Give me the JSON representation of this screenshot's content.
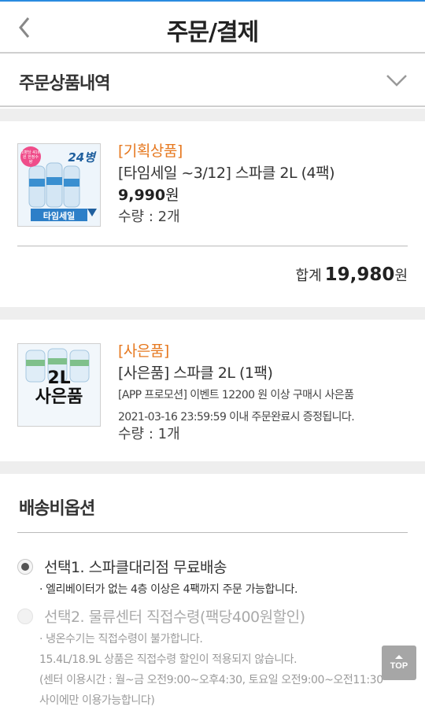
{
  "header": {
    "title": "주문/결제"
  },
  "order_section": {
    "title": "주문상품내역"
  },
  "products": [
    {
      "tag": "[기획상품]",
      "name": "[타임세일 ~3/12] 스파클 2L (4팩)",
      "price": "9,990",
      "price_unit": "원",
      "qty": "수량 : 2개",
      "thumb": {
        "badge": "1병당 416원 한정수량",
        "count": "24병",
        "label": "타임세일"
      }
    },
    {
      "tag": "[사은품]",
      "name": "[사은품] 스파클 2L (1팩)",
      "event_line1": "[APP 프로모션] 이벤트 12200 원 이상 구매시 사은품",
      "event_line2": "2021-03-16 23:59:59 이내 주문완료시 증정됩니다.",
      "qty": "수량 : 1개",
      "thumb": {
        "line1": "2L",
        "line2": "사은품"
      }
    }
  ],
  "total": {
    "label": "합계",
    "value": "19,980",
    "unit": "원"
  },
  "delivery": {
    "title": "배송비옵션",
    "options": [
      {
        "label": "선택1. 스파클대리점 무료배송",
        "selected": true,
        "notes": [
          "· 엘리베이터가 없는 4층 이상은 4팩까지 주문 가능합니다."
        ]
      },
      {
        "label": "선택2. 물류센터 직접수령(팩당400원할인)",
        "selected": false,
        "notes": [
          "· 냉온수기는 직접수령이 불가합니다.",
          "15.4L/18.9L 상품은 직접수령 할인이 적용되지 않습니다.",
          "(센터 이용시간 : 월~금 오전9:00~오후4:30, 토요일 오전9:00~오전11:30",
          "사이에만 이용가능합니다)"
        ]
      }
    ]
  },
  "top_button": {
    "label": "TOP"
  },
  "colors": {
    "accent_blue": "#2a8be0",
    "tag_orange": "#e6781f",
    "gap_gray": "#eeeeee"
  }
}
